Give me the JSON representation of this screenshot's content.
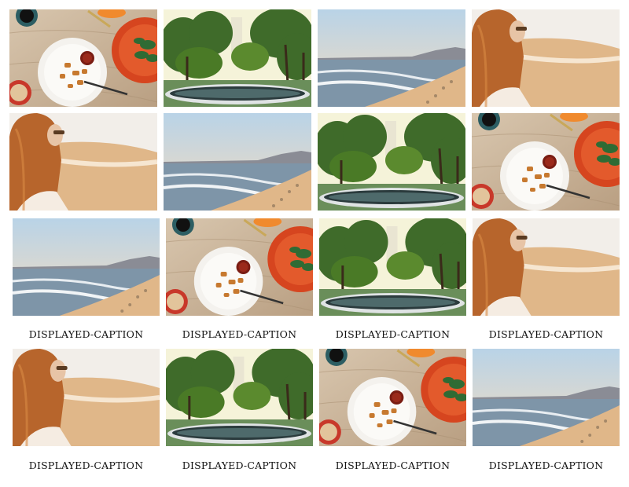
{
  "gallery": {
    "rows": [
      {
        "tiles": [
          {
            "kind": "food",
            "name": "food-photo",
            "show_caption": false
          },
          {
            "kind": "park",
            "name": "park-photo",
            "show_caption": false
          },
          {
            "kind": "beach",
            "name": "beach-photo",
            "show_caption": false
          },
          {
            "kind": "woman",
            "name": "woman-beach-photo",
            "show_caption": false
          }
        ]
      },
      {
        "tiles": [
          {
            "kind": "woman",
            "name": "woman-beach-photo",
            "show_caption": false
          },
          {
            "kind": "beach",
            "name": "beach-photo",
            "show_caption": false
          },
          {
            "kind": "park",
            "name": "park-photo",
            "show_caption": false
          },
          {
            "kind": "food",
            "name": "food-photo",
            "show_caption": false
          }
        ]
      },
      {
        "tiles": [
          {
            "kind": "beach",
            "name": "beach-photo",
            "show_caption": true
          },
          {
            "kind": "food",
            "name": "food-photo",
            "show_caption": true
          },
          {
            "kind": "park",
            "name": "park-photo",
            "show_caption": true
          },
          {
            "kind": "woman",
            "name": "woman-beach-photo",
            "show_caption": true
          }
        ]
      },
      {
        "tiles": [
          {
            "kind": "woman",
            "name": "woman-beach-photo",
            "show_caption": true
          },
          {
            "kind": "park",
            "name": "park-photo",
            "show_caption": true
          },
          {
            "kind": "food",
            "name": "food-photo",
            "show_caption": true
          },
          {
            "kind": "beach",
            "name": "beach-photo",
            "show_caption": true
          }
        ]
      }
    ],
    "caption_text": "DISPLAYED-CAPTION"
  },
  "palette": {
    "table_wood": "#cdb79c",
    "plate": "#f4f2ee",
    "red_plate": "#d6451f",
    "sky_warm": "#f3dcc0",
    "sea": "#7e95a8",
    "sand": "#e0b789",
    "foliage": "#3f6b2a",
    "hair": "#b7652c"
  }
}
